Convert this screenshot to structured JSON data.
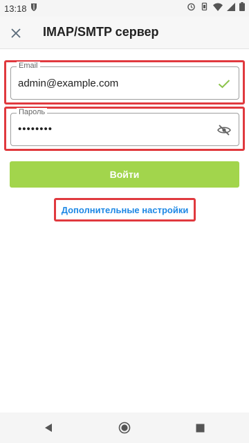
{
  "status_bar": {
    "time": "13:18",
    "icons": [
      "shield-icon",
      "alarm-icon",
      "vibrate-icon",
      "wifi-icon",
      "signal-icon",
      "battery-icon"
    ]
  },
  "header": {
    "title": "IMAP/SMTP сервер",
    "close_icon": "close-icon"
  },
  "form": {
    "email": {
      "label": "Email",
      "value": "admin@example.com",
      "status_icon": "check-icon"
    },
    "password": {
      "label": "Пароль",
      "value": "••••••••",
      "toggle_icon": "eye-off-icon"
    },
    "submit_label": "Войти",
    "advanced_link": "Дополнительные настройки"
  },
  "colors": {
    "accent_green": "#a2d54c",
    "link_blue": "#1e88e5",
    "highlight_red": "#e0393e",
    "check_green": "#8bc34a"
  },
  "nav_bar": {
    "icons": [
      "back-icon",
      "home-icon",
      "recents-icon"
    ]
  }
}
